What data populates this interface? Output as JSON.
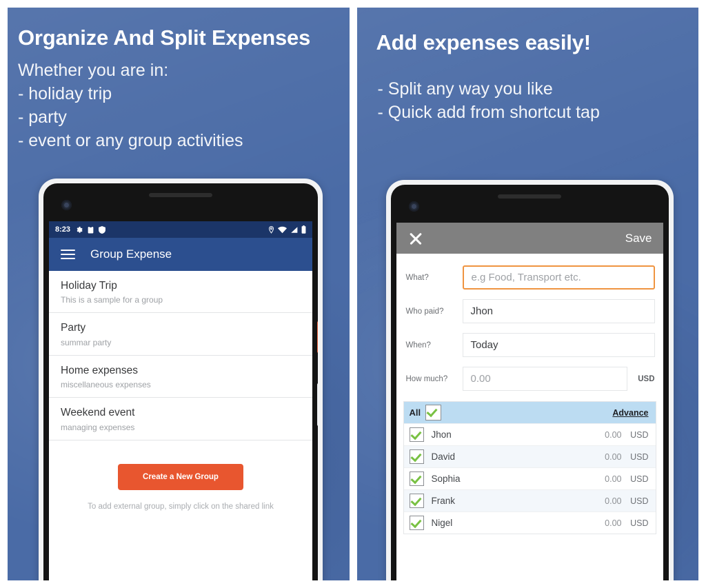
{
  "theme": {
    "panel_blue": "#4e6fa8",
    "appbar_blue": "#2c4f8f",
    "statusbar_blue": "#1b3568",
    "accent_orange": "#e8562f",
    "focus_orange": "#ef9440",
    "check_green": "#79c143",
    "table_header_blue": "#bcdcf2",
    "toolbar_gray": "#808080"
  },
  "left_panel": {
    "headline": "Organize And Split Expenses",
    "subtext_lines": [
      "Whether you are in:",
      "- holiday trip",
      "- party",
      "- event or any group activities"
    ],
    "phone": {
      "statusbar": {
        "time": "8:23",
        "left_icons": [
          "gear-icon",
          "clipboard-icon",
          "shield-icon"
        ],
        "right_icons": [
          "location-icon",
          "wifi-icon",
          "signal-icon",
          "battery-icon"
        ]
      },
      "appbar": {
        "menu_icon": "hamburger-menu-icon",
        "title": "Group Expense"
      },
      "groups": [
        {
          "title": "Holiday Trip",
          "subtitle": "This is a sample for a group"
        },
        {
          "title": "Party",
          "subtitle": "summar party"
        },
        {
          "title": "Home expenses",
          "subtitle": "miscellaneous expenses"
        },
        {
          "title": "Weekend event",
          "subtitle": "managing expenses"
        }
      ],
      "cta_label": "Create a New Group",
      "cta_hint": "To add external group, simply click on the shared link"
    }
  },
  "right_panel": {
    "headline": "Add expenses easily!",
    "subtext_lines": [
      "- Split any way you like",
      "- Quick add from shortcut tap"
    ],
    "phone": {
      "toolbar": {
        "close_icon": "close-x-icon",
        "save_label": "Save"
      },
      "form": [
        {
          "label": "What?",
          "value": "e.g Food, Transport etc.",
          "is_placeholder": true,
          "focused": true,
          "suffix": ""
        },
        {
          "label": "Who paid?",
          "value": "Jhon",
          "is_placeholder": false,
          "focused": false,
          "suffix": ""
        },
        {
          "label": "When?",
          "value": "Today",
          "is_placeholder": false,
          "focused": false,
          "suffix": ""
        },
        {
          "label": "How much?",
          "value": "0.00",
          "is_placeholder": true,
          "focused": false,
          "suffix": "USD"
        }
      ],
      "split_table": {
        "header": {
          "all_label": "All",
          "all_checked": true,
          "advance_label": "Advance"
        },
        "rows": [
          {
            "name": "Jhon",
            "checked": true,
            "amount": "0.00",
            "currency": "USD"
          },
          {
            "name": "David",
            "checked": true,
            "amount": "0.00",
            "currency": "USD"
          },
          {
            "name": "Sophia",
            "checked": true,
            "amount": "0.00",
            "currency": "USD"
          },
          {
            "name": "Frank",
            "checked": true,
            "amount": "0.00",
            "currency": "USD"
          },
          {
            "name": "Nigel",
            "checked": true,
            "amount": "0.00",
            "currency": "USD"
          }
        ]
      }
    }
  }
}
